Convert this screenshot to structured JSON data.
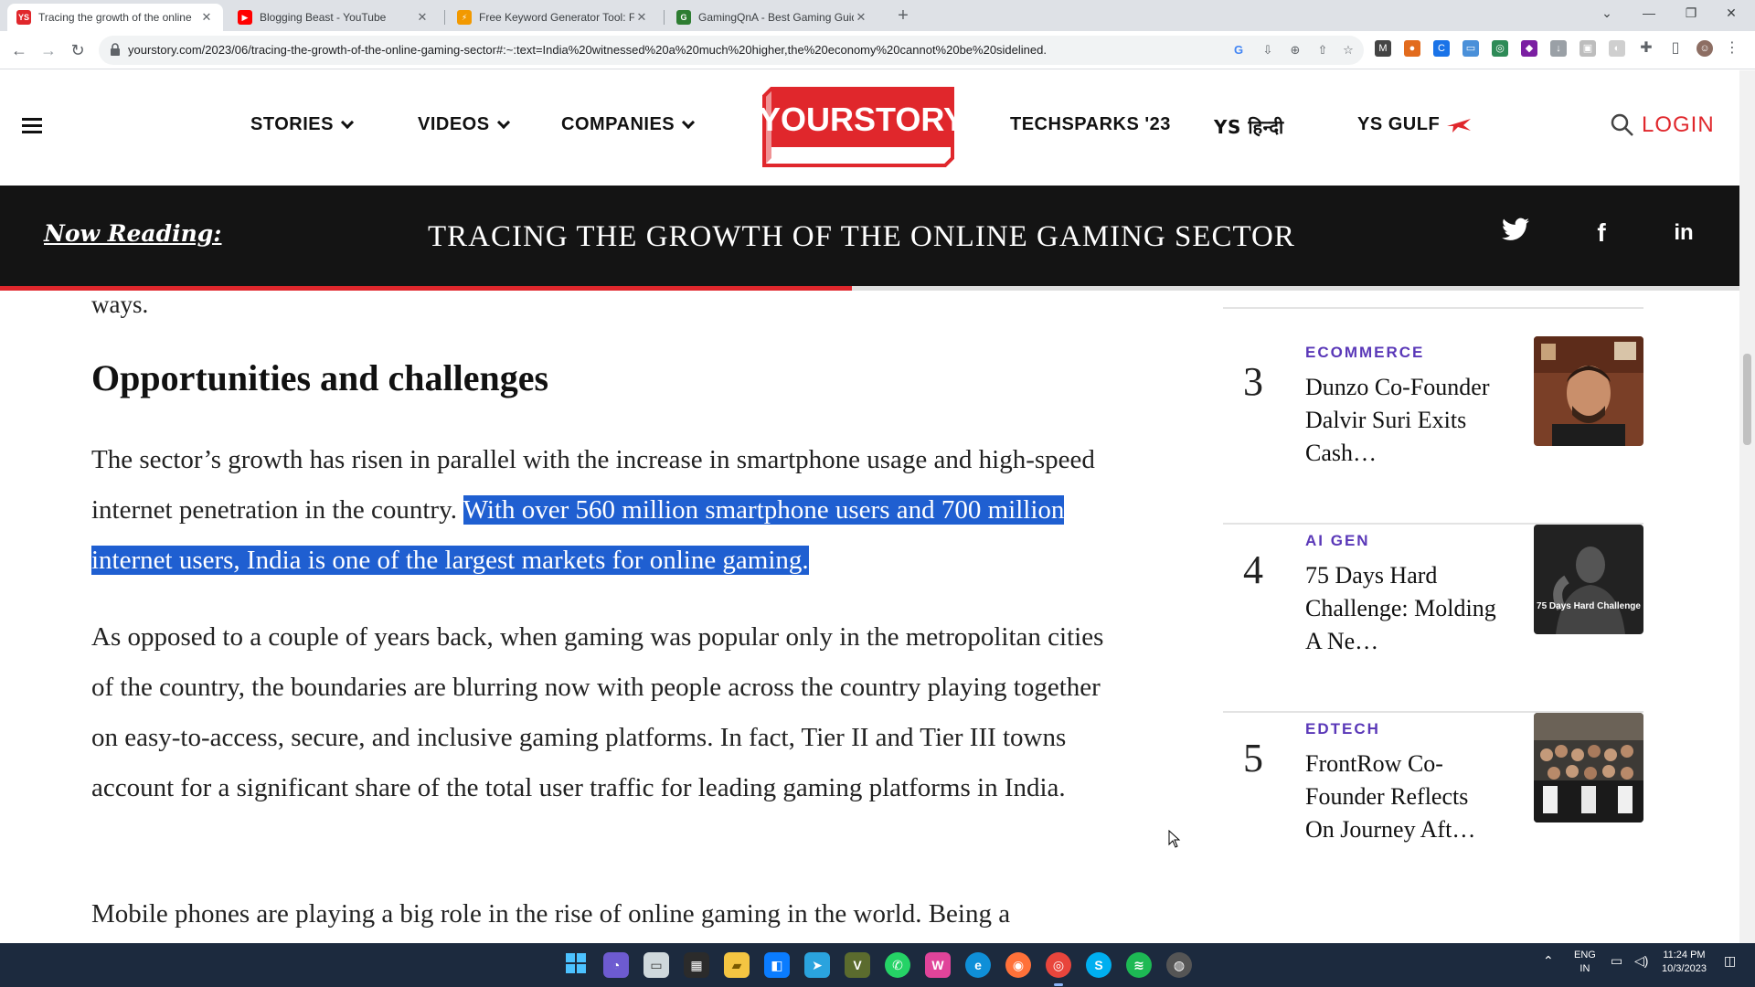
{
  "browser": {
    "tabs": [
      {
        "title": "Tracing the growth of the online",
        "favicon": "YS",
        "favicon_color": "#e0272c",
        "active": true
      },
      {
        "title": "Blogging Beast - YouTube",
        "favicon": "▶",
        "favicon_color": "#ff0000",
        "active": false
      },
      {
        "title": "Free Keyword Generator Tool: Fi",
        "favicon": "⚡",
        "favicon_color": "#f29900",
        "active": false
      },
      {
        "title": "GamingQnA - Best Gaming Guid",
        "favicon": "G",
        "favicon_color": "#2e7d32",
        "active": false
      }
    ],
    "url": "yourstory.com/2023/06/tracing-the-growth-of-the-online-gaming-sector#:~:text=India%20witnessed%20a%20much%20higher,the%20economy%20cannot%20be%20sidelined."
  },
  "header": {
    "nav_items": [
      "STORIES",
      "VIDEOS",
      "COMPANIES"
    ],
    "logo_text": "YOURSTORY",
    "right_items": [
      "TECHSPARKS '23",
      "YS हिन्दी",
      "YS GULF"
    ],
    "login": "LOGIN"
  },
  "reading_bar": {
    "label": "Now Reading:",
    "title": "TRACING THE GROWTH OF THE ONLINE GAMING SECTOR",
    "progress": 0.49
  },
  "article": {
    "fragment": "ways.",
    "heading": "Opportunities and challenges",
    "para1_before": "The sector’s growth has risen in parallel with the increase in smartphone usage and high-speed internet penetration in the country. ",
    "para1_highlight": "With over 560 million smartphone users and 700 million internet users, India is one of the largest markets for online gaming.",
    "para2": "As opposed to a couple of years back, when gaming was popular only in the metropolitan cities of the country, the boundaries are blurring now with people across the country playing together on easy-to-access, secure, and inclusive gaming platforms. In fact, Tier II and Tier III towns account for a significant share of the total user traffic for leading gaming platforms in India.",
    "para3": "Mobile phones are playing a big role in the rise of online gaming in the world. Being a"
  },
  "sidebar": {
    "items": [
      {
        "num": "3",
        "category": "ECOMMERCE",
        "title": "Dunzo Co-Founder Dalvir Suri Exits Cash…",
        "thumb": "person-portrait"
      },
      {
        "num": "4",
        "category": "AI GEN",
        "title": "75 Days Hard Challenge: Molding A Ne…",
        "thumb": "75-days-hard-challenge",
        "thumb_caption": "75 Days Hard Challenge"
      },
      {
        "num": "5",
        "category": "EDTECH",
        "title": "FrontRow Co-Founder Reflects On Journey Aft…",
        "thumb": "group-photo"
      }
    ]
  },
  "taskbar": {
    "lang": "ENG",
    "region": "IN",
    "time": "11:24 PM",
    "date": "10/3/2023"
  },
  "colors": {
    "brand_red": "#e0272c",
    "category_purple": "#5a38b8",
    "highlight_blue": "#1f5fd1"
  }
}
